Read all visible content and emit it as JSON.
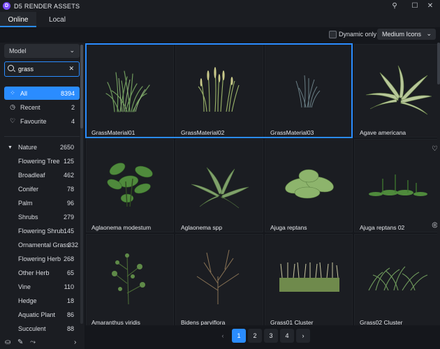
{
  "app": {
    "logo_letter": "D",
    "title": "D5 RENDER ASSETS"
  },
  "window_controls": {
    "pin": "⚲",
    "minimize": "—",
    "maximize": "☐",
    "close": "✕"
  },
  "tabs": [
    {
      "label": "Online",
      "active": true
    },
    {
      "label": "Local",
      "active": false
    }
  ],
  "toolbar": {
    "dynamic_only_label": "Dynamic only",
    "dynamic_only_checked": false,
    "view_mode": "Medium Icons"
  },
  "sidebar": {
    "model_select": "Model",
    "search": {
      "value": "grass",
      "placeholder": ""
    },
    "filters": [
      {
        "label": "All",
        "count": "8394",
        "icon": "grid-icon",
        "active": true
      },
      {
        "label": "Recent",
        "count": "2",
        "icon": "clock-icon",
        "active": false
      },
      {
        "label": "Favourite",
        "count": "4",
        "icon": "heart-icon",
        "active": false
      }
    ],
    "categories": [
      {
        "label": "Nature",
        "count": "2650",
        "expanded": true
      },
      {
        "label": "Flowering Tree",
        "count": "125"
      },
      {
        "label": "Broadleaf",
        "count": "462"
      },
      {
        "label": "Conifer",
        "count": "78"
      },
      {
        "label": "Palm",
        "count": "96"
      },
      {
        "label": "Shrubs",
        "count": "279"
      },
      {
        "label": "Flowering Shrub",
        "count": "145"
      },
      {
        "label": "Ornamental Grass",
        "count": "332"
      },
      {
        "label": "Flowering Herb",
        "count": "268"
      },
      {
        "label": "Other Herb",
        "count": "65"
      },
      {
        "label": "Vine",
        "count": "110"
      },
      {
        "label": "Hedge",
        "count": "18"
      },
      {
        "label": "Aquatic Plant",
        "count": "86"
      },
      {
        "label": "Succulent",
        "count": "88"
      }
    ]
  },
  "assets": [
    {
      "name": "GrassMaterial01",
      "kind": "grass-tall",
      "selected": true
    },
    {
      "name": "GrassMaterial02",
      "kind": "grass-seed",
      "selected": true
    },
    {
      "name": "GrassMaterial03",
      "kind": "grass-thin",
      "selected": true
    },
    {
      "name": "Agave americana",
      "kind": "agave",
      "selected": false
    },
    {
      "name": "Aglaonema modestum",
      "kind": "broadleaf",
      "selected": false,
      "favourite_icon": true
    },
    {
      "name": "Aglaonema spp",
      "kind": "aglaonema",
      "selected": false
    },
    {
      "name": "Ajuga reptans",
      "kind": "ajuga",
      "selected": false
    },
    {
      "name": "Ajuga reptans 02",
      "kind": "groundcover",
      "selected": false,
      "check_icon": true
    },
    {
      "name": "Amaranthus viridis",
      "kind": "herb",
      "selected": false
    },
    {
      "name": "Bidens parviflora",
      "kind": "twig",
      "selected": false
    },
    {
      "name": "Grass01 Cluster",
      "kind": "cluster-tall",
      "selected": false
    },
    {
      "name": "Grass02 Cluster",
      "kind": "cluster-low",
      "selected": false
    }
  ],
  "pagination": {
    "pages": [
      "1",
      "2",
      "3",
      "4"
    ],
    "current": "1",
    "prev": "‹",
    "next": "›"
  },
  "colors": {
    "accent": "#2a8cff",
    "background": "#15171c",
    "panel": "#1b1d22",
    "logo": "#7b4dff"
  }
}
